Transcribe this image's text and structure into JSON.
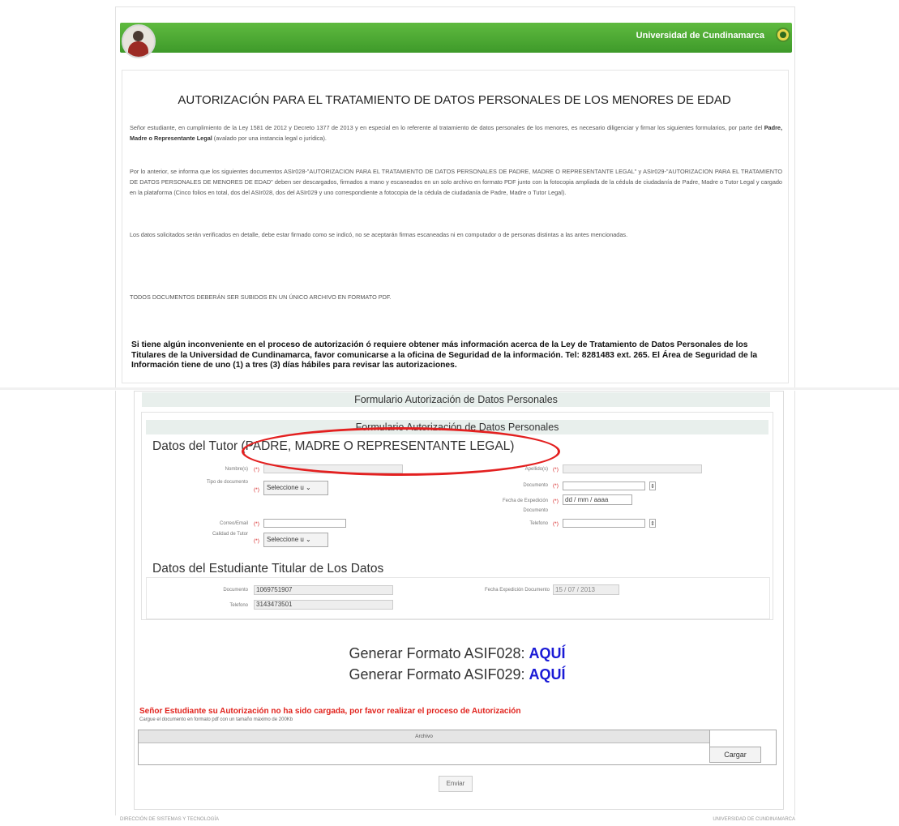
{
  "header": {
    "university": "Universidad de Cundinamarca"
  },
  "doc": {
    "title": "AUTORIZACIÓN PARA EL TRATAMIENTO DE DATOS PERSONALES DE LOS MENORES DE EDAD",
    "p1a": "Señor estudiante, en cumplimiento de la Ley 1581 de 2012 y Decreto 1377 de 2013 y en especial en lo referente al tratamiento de datos personales de los menores, es necesario diligenciar y firmar los siguientes formularios, por parte del ",
    "p1b": "Padre, Madre o Representante Legal",
    "p1c": " (avalado por una instancia legal o jurídica).",
    "p2": "Por lo anterior, se informa que los siguientes documentos ASIr028-\"AUTORIZACION PARA EL TRATAMIENTO DE DATOS PERSONALES DE PADRE, MADRE O REPRESENTANTE LEGAL\" y ASIr029-\"AUTORIZACION PARA EL TRATAMIENTO DE DATOS PERSONALES DE MENORES DE EDAD\" deben ser descargados, firmados a mano y escaneados en un solo archivo en formato PDF junto con la fotocopia ampliada de la cédula de ciudadanía de Padre, Madre o Tutor Legal y cargado en la plataforma (Cinco folios en total, dos del ASIr028, dos del ASIr029 y uno correspondiente a fotocopia de la cédula de ciudadanía de Padre, Madre o Tutor Legal).",
    "p3": "Los datos solicitados serán verificados en detalle, debe estar firmado como se indicó, no se aceptarán firmas escaneadas ni en computador o de personas distintas a las antes mencionadas.",
    "p4": "TODOS DOCUMENTOS DEBERÁN SER SUBIDOS EN UN ÚNICO ARCHIVO EN FORMATO PDF.",
    "warning": "Si tiene algún inconveniente en el proceso de autorización ó requiere obtener más información acerca de la Ley de Tratamiento de Datos Personales de los Titulares de la Universidad de Cundinamarca, favor comunicarse a la oficina de Seguridad de la información. Tel: 8281483 ext. 265. El Área de Seguridad de la Información tiene de uno (1) a tres (3) días hábiles para revisar las autorizaciones."
  },
  "form": {
    "bar1": "Formulario Autorización de Datos Personales",
    "bar2": "Formulario Autorización de Datos Personales",
    "tutor_title_a": "Datos del Tutor",
    "tutor_title_b": " (PADRE, MADRE O REPRESENTANTE LEGAL)",
    "required_mark": "(*)",
    "labels": {
      "nombres": "Nombre(s)",
      "apellidos": "Apellido(s)",
      "tipo_doc": "Tipo de documento",
      "documento": "Documento",
      "fecha_exp_1": "Fecha de Expedición",
      "fecha_exp_2": "Documento",
      "correo": "Correo/Email",
      "telefono": "Telefono",
      "calidad": "Calidad de Tutor"
    },
    "select_placeholder": "Seleccione u",
    "fecha_placeholder": "dd / mm / aaaa",
    "student_title": "Datos del Estudiante Titular de Los Datos",
    "student": {
      "doc_label": "Documento",
      "doc_value": "1069751907",
      "tel_label": "Telefono",
      "tel_value": "3143473501",
      "fecha_label": "Fecha Expedición Documento",
      "fecha_value": "15 / 07 / 2013"
    },
    "gen1_prefix": "Generar Formato ASIF028: ",
    "gen2_prefix": "Generar Formato ASIF029: ",
    "aqui": "AQUÍ",
    "red_warning": "Señor Estudiante su Autorización no ha sido cargada, por favor realizar el proceso de Autorización",
    "small_note": "Cargue el documento en formato pdf con un tamaño máximo de 200Kb",
    "archivo_header": "Archivo",
    "cargar": "Cargar",
    "enviar": "Enviar"
  },
  "footer": {
    "left": "DIRECCIÓN DE SISTEMAS Y TECNOLOGÍA",
    "right": "UNIVERSIDAD DE CUNDINAMARCA"
  },
  "colors": {
    "green": "#4caf34",
    "red": "#e1231d",
    "link": "#1a1ad6"
  }
}
